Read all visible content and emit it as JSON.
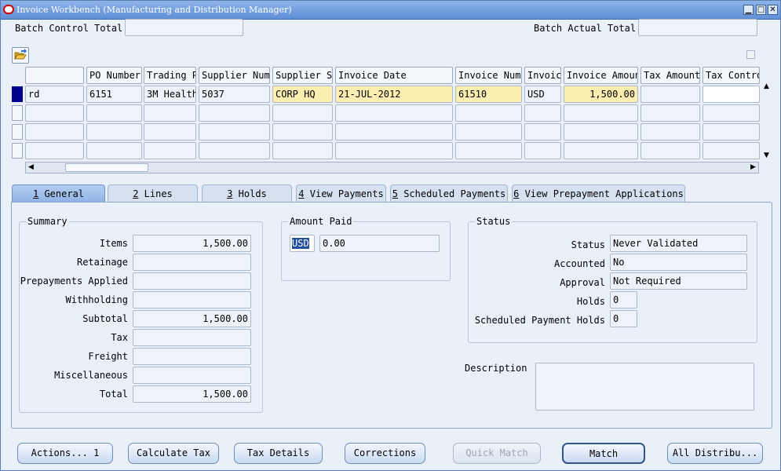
{
  "window": {
    "title": "Invoice Workbench (Manufacturing and Distribution Manager)"
  },
  "batch": {
    "control_total_label": "Batch Control Total",
    "control_total_value": "",
    "actual_total_label": "Batch Actual Total",
    "actual_total_value": ""
  },
  "grid": {
    "headers": [
      "",
      "PO Number",
      "Trading P",
      "Supplier Num",
      "Supplier S:",
      "Invoice Date",
      "Invoice Num",
      "Invoic",
      "Invoice Amoun",
      "Tax Amount",
      "Tax Contro"
    ],
    "rows": [
      [
        "rd",
        "6151",
        "3M Health",
        "5037",
        "CORP HQ",
        "21-JUL-2012",
        "61510",
        "USD",
        "1,500.00",
        "",
        ""
      ],
      [
        "",
        "",
        "",
        "",
        "",
        "",
        "",
        "",
        "",
        "",
        ""
      ],
      [
        "",
        "",
        "",
        "",
        "",
        "",
        "",
        "",
        "",
        "",
        ""
      ],
      [
        "",
        "",
        "",
        "",
        "",
        "",
        "",
        "",
        "",
        "",
        ""
      ]
    ]
  },
  "tabs": [
    {
      "num": "1",
      "label": " General"
    },
    {
      "num": "2",
      "label": " Lines"
    },
    {
      "num": "3",
      "label": " Holds"
    },
    {
      "num": "4",
      "label": " View Payments"
    },
    {
      "num": "5",
      "label": " Scheduled Payments"
    },
    {
      "num": "6",
      "label": " View Prepayment Applications"
    }
  ],
  "summary": {
    "title": "Summary",
    "items": [
      {
        "label": "Items",
        "value": "1,500.00"
      },
      {
        "label": "Retainage",
        "value": ""
      },
      {
        "label": "Prepayments Applied",
        "value": ""
      },
      {
        "label": "Withholding",
        "value": ""
      },
      {
        "label": "Subtotal",
        "value": "1,500.00"
      },
      {
        "label": "Tax",
        "value": ""
      },
      {
        "label": "Freight",
        "value": ""
      },
      {
        "label": "Miscellaneous",
        "value": ""
      },
      {
        "label": "Total",
        "value": "1,500.00"
      }
    ]
  },
  "amount_paid": {
    "title": "Amount Paid",
    "currency": "USD",
    "value": "0.00"
  },
  "status": {
    "title": "Status",
    "items": [
      {
        "label": "Status",
        "value": "Never Validated"
      },
      {
        "label": "Accounted",
        "value": "No"
      },
      {
        "label": "Approval",
        "value": "Not Required"
      },
      {
        "label": "Holds",
        "value": "0"
      },
      {
        "label": "Scheduled Payment Holds",
        "value": "0"
      }
    ]
  },
  "description": {
    "label": "Description",
    "value": ""
  },
  "buttons": {
    "actions": "Actions... 1",
    "calc_tax": "Calculate Tax",
    "tax_details": "Tax Details",
    "corrections": "Corrections",
    "quick_match": "Quick Match",
    "match": "Match",
    "all_distrib": "All Distribu..."
  },
  "colors": {
    "title_bar": "#5f8fd6",
    "required_field": "#fcedb0",
    "selected_row": "#00008b"
  },
  "icons": [
    "oracle-icon",
    "minimize-icon",
    "restore-icon",
    "close-icon",
    "folder-open-icon"
  ]
}
